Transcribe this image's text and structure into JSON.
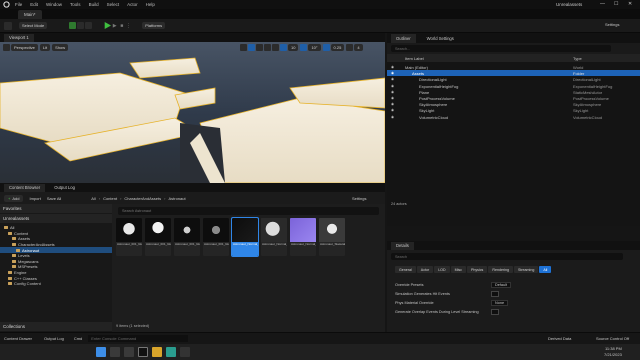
{
  "titlebar": {
    "menu": [
      "File",
      "Edit",
      "Window",
      "Tools",
      "Build",
      "Select",
      "Actor",
      "Help"
    ],
    "project": "Unrealassets"
  },
  "tabs": {
    "level": "Main*"
  },
  "toolbar": {
    "select_mode": "Select Mode",
    "platforms": "Platforms",
    "settings": "Settings"
  },
  "viewport": {
    "tab": "Viewport 1",
    "perspective": "Perspective",
    "lit": "Lit",
    "show": "Show",
    "fov": "10°",
    "snap": "0.25",
    "speed": "4",
    "grid": "10"
  },
  "content_browser": {
    "tab": "Content Browser",
    "output_log": "Output Log",
    "add": "Add",
    "import": "Import",
    "save_all": "Save All",
    "path": [
      "All",
      "Content",
      "CharacterAndAssets",
      "Astronaut"
    ],
    "settings": "Settings",
    "favorites": "Favorites",
    "project": "Unrealassets",
    "search_placeholder": "Search Astronaut",
    "tree": [
      {
        "label": "All",
        "indent": 0,
        "selected": false
      },
      {
        "label": "Content",
        "indent": 1,
        "selected": false
      },
      {
        "label": "Assets",
        "indent": 2,
        "selected": false
      },
      {
        "label": "CharacterAndAssets",
        "indent": 2,
        "selected": false
      },
      {
        "label": "Astronaut",
        "indent": 3,
        "selected": true
      },
      {
        "label": "Levels",
        "indent": 2,
        "selected": false
      },
      {
        "label": "Megascans",
        "indent": 2,
        "selected": false
      },
      {
        "label": "MSPresets",
        "indent": 2,
        "selected": false
      },
      {
        "label": "Engine",
        "indent": 1,
        "selected": false
      },
      {
        "label": "C++ Classes",
        "indent": 1,
        "selected": false
      },
      {
        "label": "Config Content",
        "indent": 1,
        "selected": false
      }
    ],
    "collections": "Collections",
    "items_count": "9 items (1 selected)",
    "assets": [
      {
        "label": "Astronaut_001_Glass_B...",
        "kind": "white-suit"
      },
      {
        "label": "Astronaut_001_Glass_B...",
        "kind": "white-helmet"
      },
      {
        "label": "Astronaut_001_Glass_B...",
        "kind": "dark-suit"
      },
      {
        "label": "Astronaut_001_Glass_B...",
        "kind": "dark-pack"
      },
      {
        "label": "Astronaut_Normal_Blue",
        "kind": "blue-selected"
      },
      {
        "label": "Astronaut_Normal_Blue",
        "kind": "sphere"
      },
      {
        "label": "Astronaut_Normal_PBR",
        "kind": "purple"
      },
      {
        "label": "Astronaut_Skeletal_Mesh",
        "kind": "figure"
      }
    ]
  },
  "outliner": {
    "tab": "Outliner",
    "world_settings": "World Settings",
    "search_placeholder": "Search...",
    "col_label": "Item Label",
    "col_type": "Type",
    "rows": [
      {
        "label": "Main (Editor)",
        "type": "World",
        "indent": 0,
        "selected": false
      },
      {
        "label": "Assets",
        "type": "Folder",
        "indent": 1,
        "selected": true
      },
      {
        "label": "DirectionalLight",
        "type": "DirectionalLight",
        "indent": 2,
        "selected": false
      },
      {
        "label": "ExponentialHeightFog",
        "type": "ExponentialHeightFog",
        "indent": 2,
        "selected": false
      },
      {
        "label": "Plane",
        "type": "StaticMeshActor",
        "indent": 2,
        "selected": false
      },
      {
        "label": "PostProcessVolume",
        "type": "PostProcessVolume",
        "indent": 2,
        "selected": false
      },
      {
        "label": "SkyAtmosphere",
        "type": "SkyAtmosphere",
        "indent": 2,
        "selected": false
      },
      {
        "label": "SkyLight",
        "type": "SkyLight",
        "indent": 2,
        "selected": false
      },
      {
        "label": "VolumetricCloud",
        "type": "VolumetricCloud",
        "indent": 2,
        "selected": false
      }
    ],
    "actors_count": "24 actors"
  },
  "details": {
    "tab": "Details",
    "search_placeholder": "Search",
    "categories": [
      "General",
      "Actor",
      "LOD",
      "Misc",
      "Physics",
      "Rendering",
      "Streaming",
      "All"
    ],
    "active_category": "All",
    "props": [
      {
        "label": "Override Presets",
        "value": "Default"
      },
      {
        "label": "Simulation Generates Hit Events",
        "value": ""
      },
      {
        "label": "Phys Material Override",
        "value": "None"
      },
      {
        "label": "Generate Overlap Events During Level Streaming",
        "value": ""
      }
    ]
  },
  "statusbar": {
    "content_drawer": "Content Drawer",
    "output_log": "Output Log",
    "cmd": "Cmd",
    "cmd_placeholder": "Enter Console Command",
    "derived_data": "Derived Data",
    "source_control": "Source Control Off"
  },
  "taskbar": {
    "time": "11:38 PM",
    "date": "7/21/2023"
  },
  "colors": {
    "accent": "#1d63b8",
    "selected_blue": "#2f86e8",
    "floor": "#f1e8d4",
    "outline": "#e6b22a"
  }
}
